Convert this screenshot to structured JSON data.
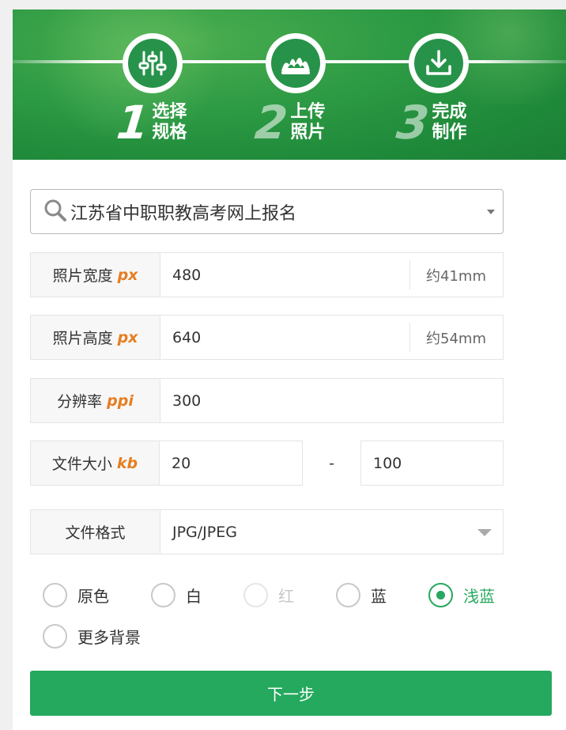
{
  "banner": {
    "steps": [
      {
        "number": "1",
        "line1": "选择",
        "line2": "规格",
        "icon": "sliders-icon"
      },
      {
        "number": "2",
        "line1": "上传",
        "line2": "照片",
        "icon": "photo-icon"
      },
      {
        "number": "3",
        "line1": "完成",
        "line2": "制作",
        "icon": "download-icon"
      }
    ],
    "colors": {
      "banner_green": "#2e9b45",
      "icon_green": "#27934a"
    }
  },
  "spec_select": {
    "value": "江苏省中职职教高考网上报名",
    "icon": "search-icon"
  },
  "fields": {
    "width": {
      "label": "照片宽度",
      "unit": "px",
      "value": "480",
      "suffix": "约41mm"
    },
    "height": {
      "label": "照片高度",
      "unit": "px",
      "value": "640",
      "suffix": "约54mm"
    },
    "resolution": {
      "label": "分辨率",
      "unit": "ppi",
      "value": "300"
    },
    "file_size": {
      "label": "文件大小",
      "unit": "kb",
      "min": "20",
      "separator": "-",
      "max": "100"
    },
    "format": {
      "label": "文件格式",
      "value": "JPG/JPEG"
    }
  },
  "background_options": [
    {
      "label": "原色",
      "state": "unchecked"
    },
    {
      "label": "白",
      "state": "unchecked"
    },
    {
      "label": "红",
      "state": "disabled"
    },
    {
      "label": "蓝",
      "state": "unchecked"
    },
    {
      "label": "浅蓝",
      "state": "checked"
    },
    {
      "label": "更多背景",
      "state": "unchecked"
    }
  ],
  "next_button": {
    "label": "下一步"
  },
  "colors": {
    "accent_green": "#24a95e",
    "unit_orange": "#e67e22"
  }
}
